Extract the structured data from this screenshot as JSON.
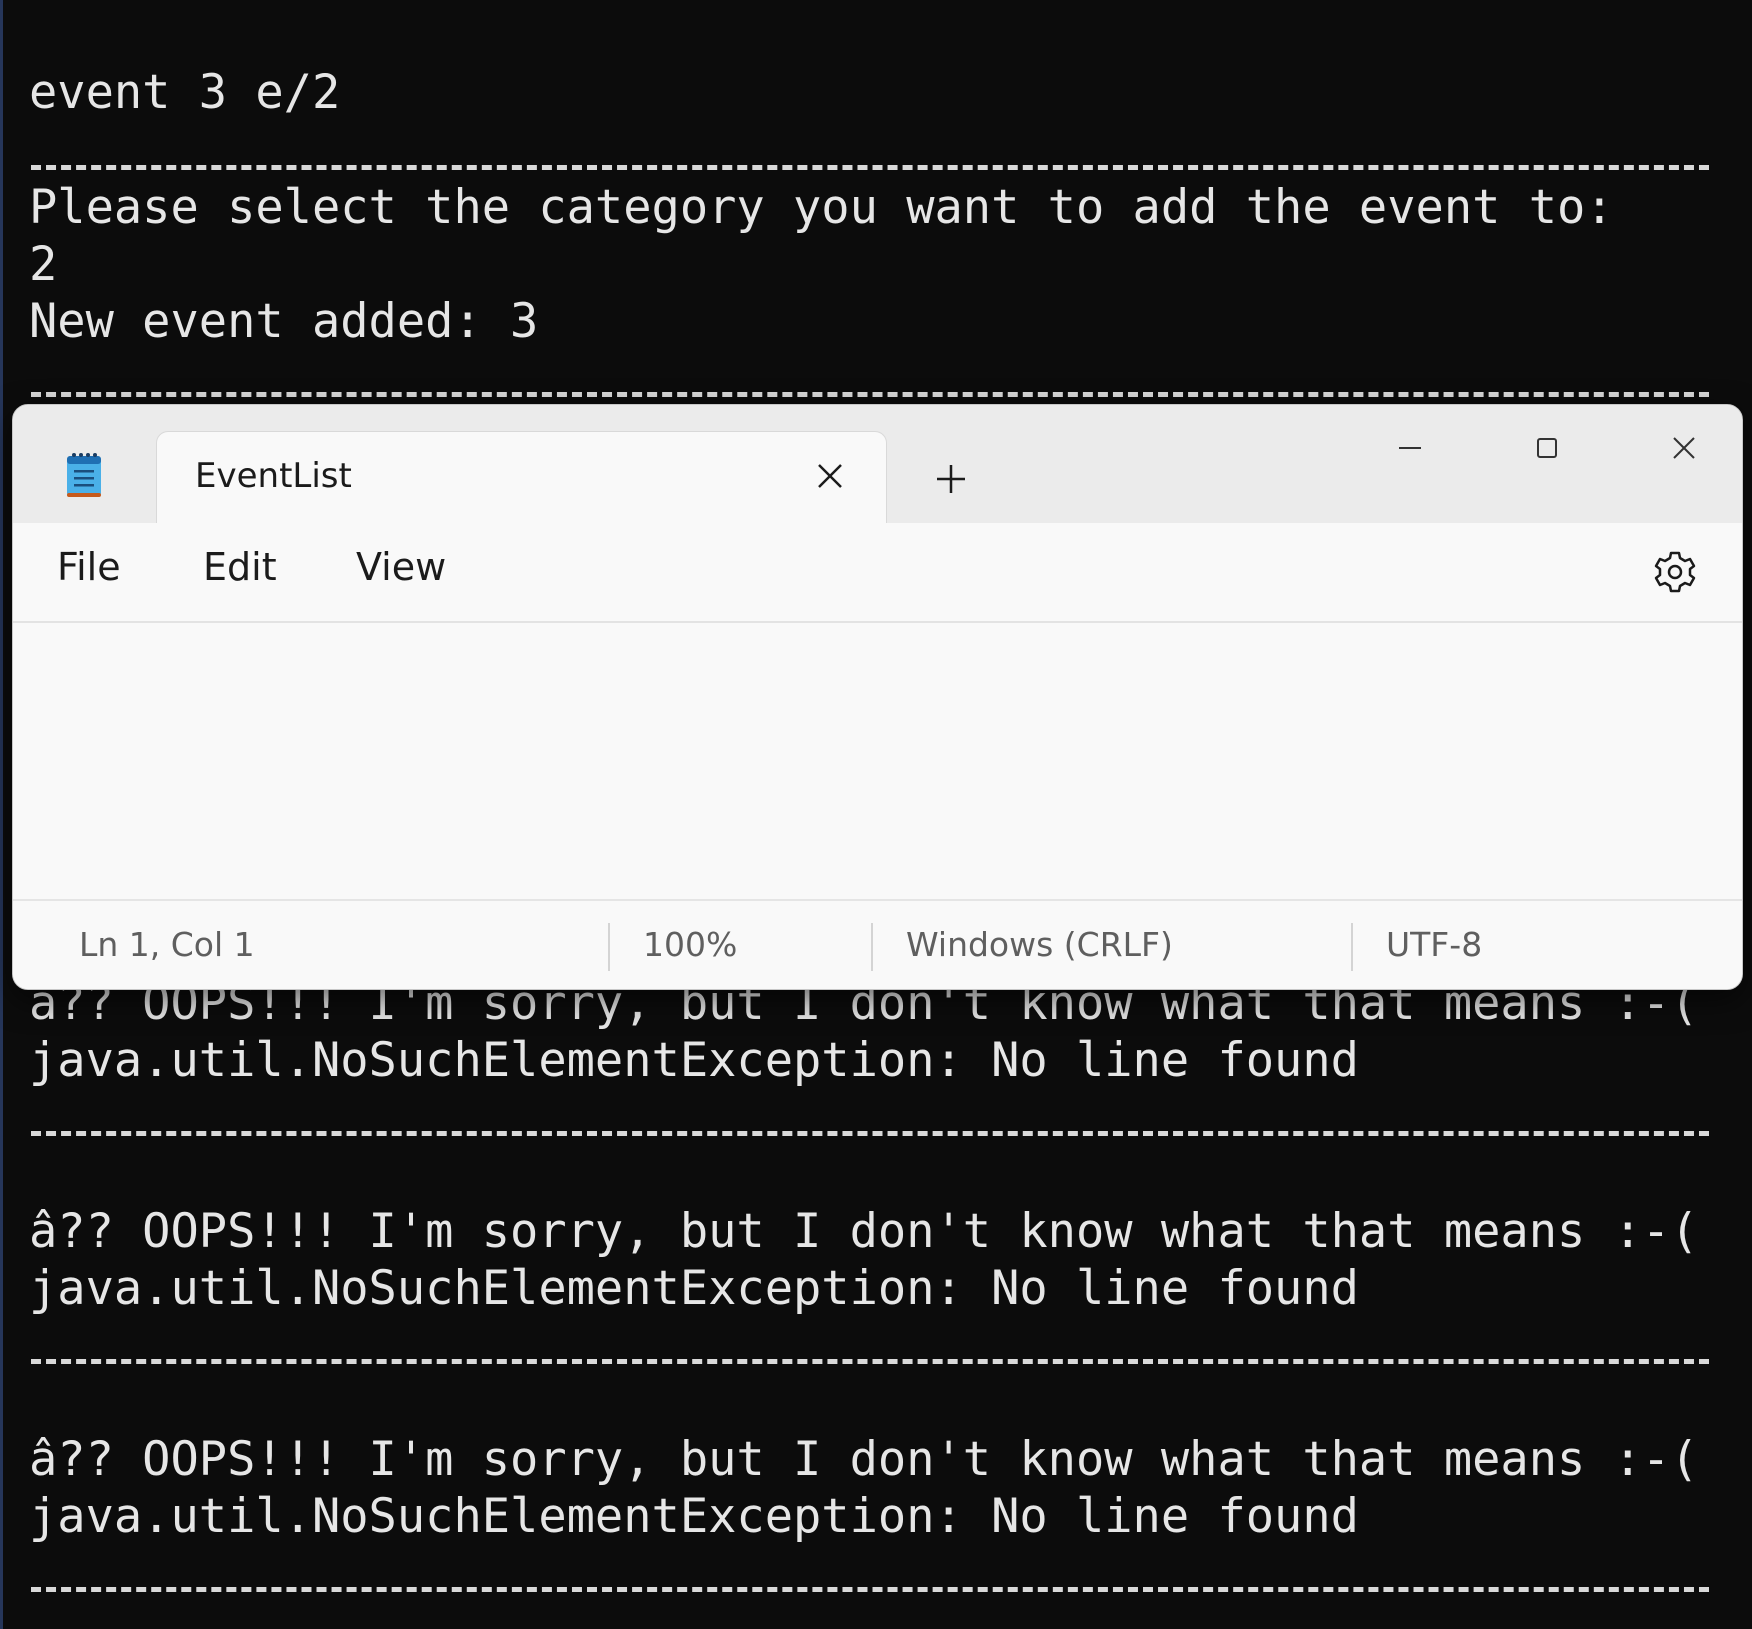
{
  "terminal": {
    "lines": [
      "event 3 e/2",
      "Please select the category you want to add the event to:",
      "2",
      "New event added: 3",
      "â?? OOPS!!! I'm sorry, but I don't know what that means :-(",
      "java.util.NoSuchElementException: No line found",
      "â?? OOPS!!! I'm sorry, but I don't know what that means :-(",
      "java.util.NoSuchElementException: No line found",
      "â?? OOPS!!! I'm sorry, but I don't know what that means :-(",
      "java.util.NoSuchElementException: No line found"
    ]
  },
  "notepad": {
    "tab_title": "EventList",
    "icons": {
      "app": "notepad-icon",
      "tab_close": "close-icon",
      "new_tab": "plus-icon",
      "minimize": "minimize-icon",
      "maximize": "maximize-icon",
      "close": "close-icon",
      "settings": "gear-icon"
    },
    "menu": {
      "file": "File",
      "edit": "Edit",
      "view": "View"
    },
    "editor_text": "",
    "status": {
      "position": "Ln 1, Col 1",
      "zoom": "100%",
      "line_endings": "Windows (CRLF)",
      "encoding": "UTF-8"
    }
  },
  "colors": {
    "terminal_bg": "#0c0c0c",
    "terminal_text": "#e6e6e6",
    "notepad_bg": "#f9f9f9",
    "titlebar_bg": "#ebebeb"
  }
}
